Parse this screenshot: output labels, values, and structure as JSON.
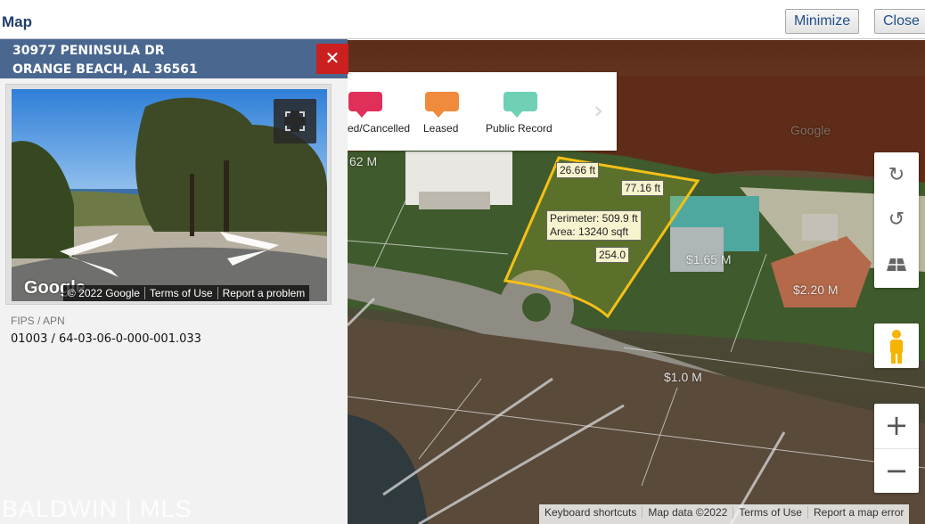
{
  "window": {
    "title": "Map",
    "minimize_label": "Minimize",
    "close_label": "Close"
  },
  "property": {
    "address_line1": "30977 PENINSULA DR",
    "address_line2": "ORANGE BEACH, AL 36561",
    "close_icon": "close-icon",
    "fips_label": "FIPS / APN",
    "fips_value": "01003 / 64-03-06-0-000-001.033"
  },
  "streetview": {
    "logo": "Google",
    "credits": [
      "© 2022 Google",
      "Terms of Use",
      "Report a problem"
    ],
    "fullscreen_icon": "fullscreen-icon"
  },
  "legend": {
    "items": [
      {
        "label": "ed/Cancelled",
        "color": "#e0305a"
      },
      {
        "label": "Leased",
        "color": "#f08a3c"
      },
      {
        "label": "Public Record",
        "color": "#6fd0b5"
      }
    ],
    "next_icon": "chevron-right-icon"
  },
  "measurement": {
    "perimeter": "Perimeter: 509.9 ft",
    "area": "Area: 13240 sqft",
    "edges": [
      "26.66 ft",
      "77.16 ft",
      "254.0"
    ]
  },
  "map_labels": [
    "62 M",
    "$1.65 M",
    "$2.20 M",
    "$1.0 M",
    "Google"
  ],
  "controls": {
    "rotate_cw_icon": "rotate-clockwise-icon",
    "rotate_ccw_icon": "rotate-counterclockwise-icon",
    "tilt_icon": "tilt-icon",
    "pegman_icon": "pegman-icon",
    "zoom_in": "+",
    "zoom_out": "−"
  },
  "footer": [
    "Keyboard shortcuts",
    "Map data ©2022",
    "Terms of Use",
    "Report a map error"
  ],
  "watermark": "BALDWIN | MLS",
  "colors": {
    "header_blue": "#4a6790",
    "close_red": "#cc1f1f",
    "boundary": "#f5c016"
  }
}
